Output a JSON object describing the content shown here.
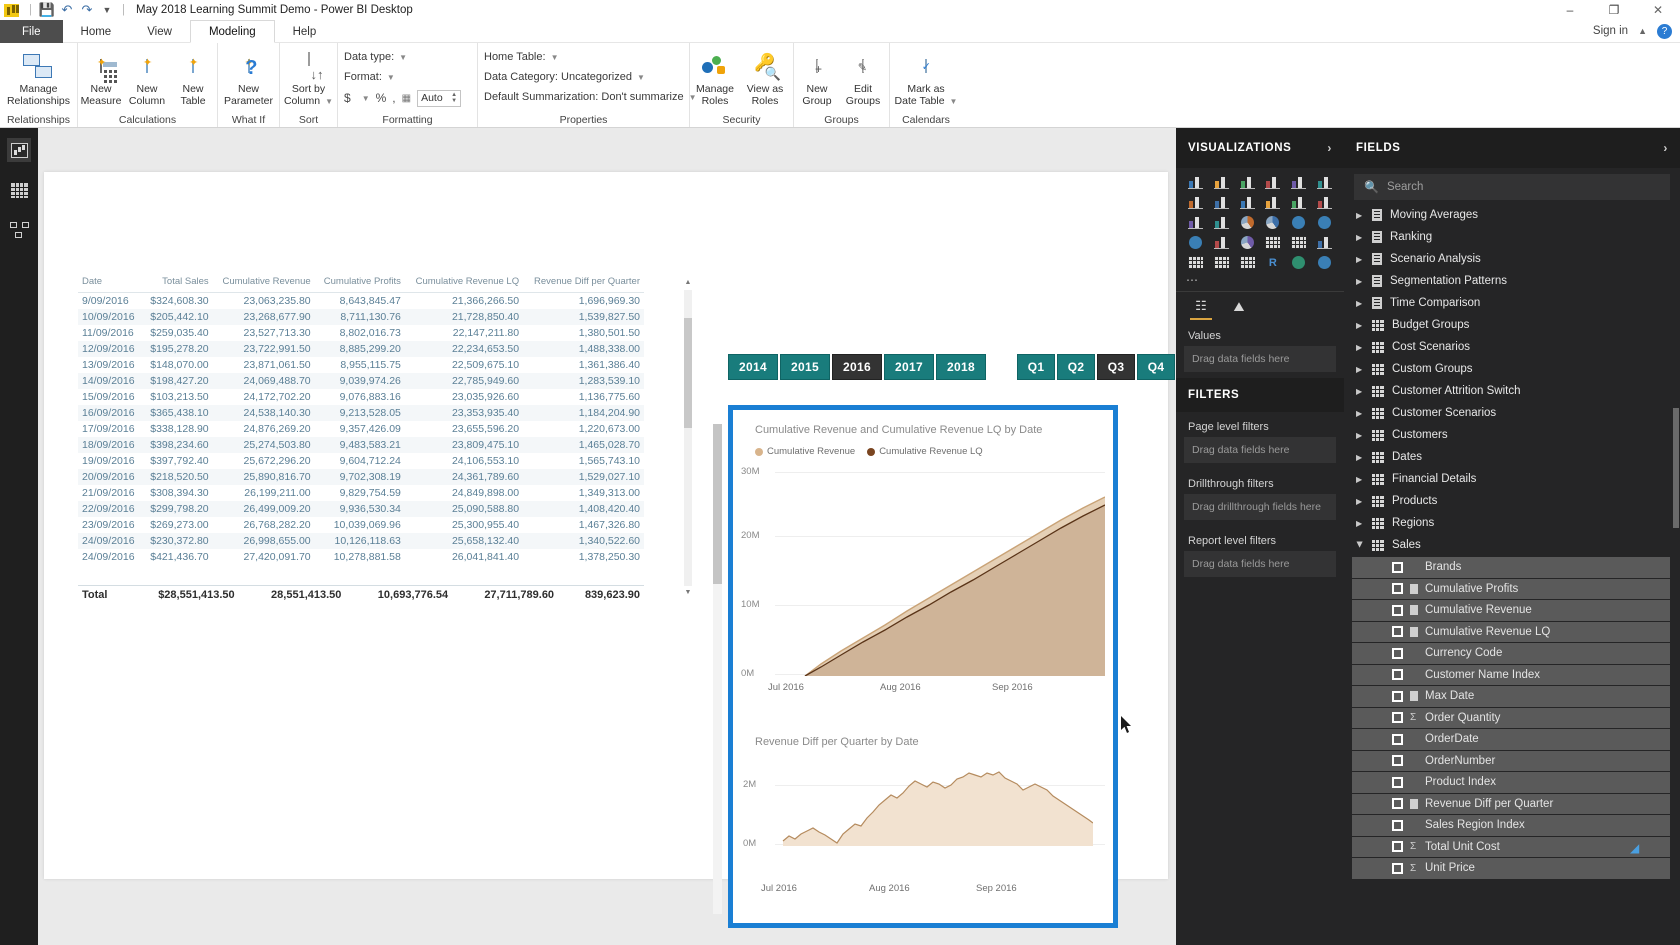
{
  "titlebar": {
    "app_title": "May 2018 Learning Summit Demo - Power BI Desktop",
    "save_icon": "save-icon",
    "undo_icon": "undo-icon",
    "redo_icon": "redo-icon",
    "customize_icon": "customize-quick-access-icon",
    "minimize": "–",
    "maximize": "❐",
    "close": "✕"
  },
  "menubar": {
    "tabs": [
      {
        "label": "File",
        "active": false,
        "file": true
      },
      {
        "label": "Home",
        "active": false
      },
      {
        "label": "View",
        "active": false
      },
      {
        "label": "Modeling",
        "active": true
      },
      {
        "label": "Help",
        "active": false
      }
    ],
    "signin_label": "Sign in",
    "help_label": "?"
  },
  "ribbon": {
    "groups": [
      {
        "name": "Relationships",
        "buttons": [
          {
            "line1": "Manage",
            "line2": "Relationships",
            "icon": "manage-relationships-icon"
          }
        ]
      },
      {
        "name": "Calculations",
        "buttons": [
          {
            "line1": "New",
            "line2": "Measure",
            "icon": "new-measure-icon"
          },
          {
            "line1": "New",
            "line2": "Column",
            "icon": "new-column-icon"
          },
          {
            "line1": "New",
            "line2": "Table",
            "icon": "new-table-icon"
          }
        ]
      },
      {
        "name": "What If",
        "buttons": [
          {
            "line1": "New",
            "line2": "Parameter",
            "icon": "new-parameter-icon"
          }
        ]
      },
      {
        "name": "Sort",
        "buttons": [
          {
            "line1": "Sort by",
            "line2": "Column",
            "icon": "sort-by-column-icon"
          }
        ]
      }
    ],
    "formatting": {
      "group_name": "Formatting",
      "data_type_label": "Data type:",
      "format_label": "Format:",
      "currency_symbol": "$",
      "percent_symbol": "%",
      "comma_symbol": ",",
      "decimal_icon": "decimal-places-icon",
      "auto_value": "Auto"
    },
    "properties": {
      "group_name": "Properties",
      "home_table_label": "Home Table:",
      "data_category_label": "Data Category: Uncategorized",
      "default_summarization_label": "Default Summarization: Don't summarize"
    },
    "security": {
      "group_name": "Security",
      "buttons": [
        {
          "line1": "Manage",
          "line2": "Roles",
          "icon": "manage-roles-icon"
        },
        {
          "line1": "View as",
          "line2": "Roles",
          "icon": "view-as-roles-icon"
        }
      ]
    },
    "groups_section": {
      "group_name": "Groups",
      "buttons": [
        {
          "line1": "New",
          "line2": "Group",
          "icon": "new-group-icon"
        },
        {
          "line1": "Edit",
          "line2": "Groups",
          "icon": "edit-groups-icon"
        }
      ]
    },
    "calendars": {
      "group_name": "Calendars",
      "buttons": [
        {
          "line1": "Mark as",
          "line2": "Date Table",
          "icon": "mark-as-date-table-icon"
        }
      ]
    }
  },
  "view_rail": {
    "items": [
      {
        "name": "report-view",
        "icon": "report-view-icon",
        "selected": true
      },
      {
        "name": "data-view",
        "icon": "data-view-icon",
        "selected": false
      },
      {
        "name": "model-view",
        "icon": "model-view-icon",
        "selected": false
      }
    ]
  },
  "table_visual": {
    "columns": [
      "Date",
      "Total Sales",
      "Cumulative Revenue",
      "Cumulative Profits",
      "Cumulative Revenue LQ",
      "Revenue Diff per Quarter"
    ],
    "rows": [
      [
        "9/09/2016",
        "$324,608.30",
        "23,063,235.80",
        "8,643,845.47",
        "21,366,266.50",
        "1,696,969.30"
      ],
      [
        "10/09/2016",
        "$205,442.10",
        "23,268,677.90",
        "8,711,130.76",
        "21,728,850.40",
        "1,539,827.50"
      ],
      [
        "11/09/2016",
        "$259,035.40",
        "23,527,713.30",
        "8,802,016.73",
        "22,147,211.80",
        "1,380,501.50"
      ],
      [
        "12/09/2016",
        "$195,278.20",
        "23,722,991.50",
        "8,885,299.20",
        "22,234,653.50",
        "1,488,338.00"
      ],
      [
        "13/09/2016",
        "$148,070.00",
        "23,871,061.50",
        "8,955,115.75",
        "22,509,675.10",
        "1,361,386.40"
      ],
      [
        "14/09/2016",
        "$198,427.20",
        "24,069,488.70",
        "9,039,974.26",
        "22,785,949.60",
        "1,283,539.10"
      ],
      [
        "15/09/2016",
        "$103,213.50",
        "24,172,702.20",
        "9,076,883.16",
        "23,035,926.60",
        "1,136,775.60"
      ],
      [
        "16/09/2016",
        "$365,438.10",
        "24,538,140.30",
        "9,213,528.05",
        "23,353,935.40",
        "1,184,204.90"
      ],
      [
        "17/09/2016",
        "$338,128.90",
        "24,876,269.20",
        "9,357,426.09",
        "23,655,596.20",
        "1,220,673.00"
      ],
      [
        "18/09/2016",
        "$398,234.60",
        "25,274,503.80",
        "9,483,583.21",
        "23,809,475.10",
        "1,465,028.70"
      ],
      [
        "19/09/2016",
        "$397,792.40",
        "25,672,296.20",
        "9,604,712.24",
        "24,106,553.10",
        "1,565,743.10"
      ],
      [
        "20/09/2016",
        "$218,520.50",
        "25,890,816.70",
        "9,702,308.19",
        "24,361,789.60",
        "1,529,027.10"
      ],
      [
        "21/09/2016",
        "$308,394.30",
        "26,199,211.00",
        "9,829,754.59",
        "24,849,898.00",
        "1,349,313.00"
      ],
      [
        "22/09/2016",
        "$299,798.20",
        "26,499,009.20",
        "9,936,530.34",
        "25,090,588.80",
        "1,408,420.40"
      ],
      [
        "23/09/2016",
        "$269,273.00",
        "26,768,282.20",
        "10,039,069.96",
        "25,300,955.40",
        "1,467,326.80"
      ],
      [
        "24/09/2016",
        "$230,372.80",
        "26,998,655.00",
        "10,126,118.63",
        "25,658,132.40",
        "1,340,522.60"
      ],
      [
        "24/09/2016",
        "$421,436.70",
        "27,420,091.70",
        "10,278,881.58",
        "26,041,841.40",
        "1,378,250.30"
      ]
    ],
    "total_row": [
      "Total",
      "$28,551,413.50",
      "28,551,413.50",
      "10,693,776.54",
      "27,711,789.60",
      "839,623.90"
    ]
  },
  "slicers": {
    "year": {
      "options": [
        "2014",
        "2015",
        "2016",
        "2017",
        "2018"
      ],
      "selected": "2016"
    },
    "quarter": {
      "options": [
        "Q1",
        "Q2",
        "Q3",
        "Q4"
      ],
      "selected": "Q3"
    }
  },
  "chart_data": [
    {
      "type": "area",
      "title": "Cumulative Revenue and Cumulative Revenue LQ by Date",
      "xlabel": "",
      "ylabel": "",
      "ylim": [
        0,
        32000000
      ],
      "yticks": [
        "0M",
        "10M",
        "20M",
        "30M"
      ],
      "xticks": [
        "Jul 2016",
        "Aug 2016",
        "Sep 2016"
      ],
      "grid": true,
      "legend_position": "top-left",
      "series": [
        {
          "name": "Cumulative Revenue",
          "color": "#d8b48c",
          "values": [
            0,
            1200000,
            2600000,
            4100000,
            5600000,
            7100000,
            8700000,
            10200000,
            11800000,
            13400000,
            15000000,
            16600000,
            18300000,
            19900000,
            21500000,
            23100000,
            24800000,
            26400000,
            27800000
          ]
        },
        {
          "name": "Cumulative Revenue LQ",
          "color": "#7a4520",
          "values": [
            0,
            1100000,
            2450000,
            3900000,
            5350000,
            6800000,
            8350000,
            9800000,
            11350000,
            12900000,
            14450000,
            16000000,
            17650000,
            19200000,
            20750000,
            22300000,
            23950000,
            25500000,
            26900000
          ]
        }
      ]
    },
    {
      "type": "area",
      "title": "Revenue Diff per Quarter by Date",
      "xlabel": "",
      "ylabel": "",
      "ylim": [
        0,
        2400000
      ],
      "yticks": [
        "0M",
        "2M"
      ],
      "xticks": [
        "Jul 2016",
        "Aug 2016",
        "Sep 2016"
      ],
      "grid": true,
      "legend_position": "none",
      "series": [
        {
          "name": "Revenue Diff per Quarter",
          "color": "#c79a6d",
          "values": [
            100000,
            160000,
            120000,
            210000,
            260000,
            300000,
            240000,
            190000,
            120000,
            60000,
            230000,
            330000,
            420000,
            380000,
            560000,
            700000,
            900000,
            1080000,
            1260000,
            1180000,
            1350000,
            1620000,
            1800000,
            1720000,
            1640000,
            1760000,
            1700000,
            1600000,
            1680000,
            1840000,
            1900000,
            2040000,
            1980000,
            1920000,
            2060000,
            2000000,
            2100000,
            1960000,
            1880000,
            1800000,
            1620000,
            1700000,
            1780000,
            1720000,
            1640000,
            1500000,
            1400000
          ]
        }
      ]
    }
  ],
  "visualizations_pane": {
    "header": "VISUALIZATIONS",
    "expand_icon": "chevron-right-icon",
    "icons": [
      "stacked-bar-chart-icon",
      "stacked-column-chart-icon",
      "clustered-bar-chart-icon",
      "clustered-column-chart-icon",
      "100-stacked-bar-icon",
      "100-stacked-column-icon",
      "line-chart-icon",
      "area-chart-icon",
      "stacked-area-chart-icon",
      "line-stacked-column-icon",
      "line-clustered-column-icon",
      "ribbon-chart-icon",
      "waterfall-chart-icon",
      "scatter-chart-icon",
      "pie-chart-icon",
      "donut-chart-icon",
      "treemap-icon",
      "map-icon",
      "filled-map-icon",
      "funnel-icon",
      "gauge-icon",
      "card-icon",
      "multi-row-card-icon",
      "kpi-icon",
      "slicer-icon",
      "table-icon",
      "matrix-icon",
      "r-script-visual-icon",
      "python-visual-icon",
      "arcgis-map-icon"
    ],
    "more_icon": "more-visuals-icon",
    "field_tabs": [
      {
        "name": "fields-tab",
        "icon": "fields-tab-icon",
        "active": true
      },
      {
        "name": "format-tab",
        "icon": "paint-roller-icon",
        "active": false
      }
    ],
    "wells": [
      {
        "label": "Values",
        "placeholder": "Drag data fields here"
      }
    ],
    "filters_header": "FILTERS",
    "filters": [
      {
        "label": "Page level filters",
        "placeholder": "Drag data fields here"
      },
      {
        "label": "Drillthrough filters",
        "placeholder": "Drag drillthrough fields here"
      },
      {
        "label": "Report level filters",
        "placeholder": "Drag data fields here"
      }
    ]
  },
  "fields_pane": {
    "header": "FIELDS",
    "expand_icon": "chevron-right-icon",
    "search_placeholder": "Search",
    "search_icon": "search-icon",
    "tables": [
      {
        "label": "Moving Averages",
        "kind": "calc-group",
        "expanded": false
      },
      {
        "label": "Ranking",
        "kind": "calc-group",
        "expanded": false
      },
      {
        "label": "Scenario Analysis",
        "kind": "calc-group",
        "expanded": false
      },
      {
        "label": "Segmentation Patterns",
        "kind": "calc-group",
        "expanded": false
      },
      {
        "label": "Time Comparison",
        "kind": "calc-group",
        "expanded": false
      },
      {
        "label": "Budget Groups",
        "kind": "table",
        "expanded": false
      },
      {
        "label": "Cost Scenarios",
        "kind": "table",
        "expanded": false
      },
      {
        "label": "Custom Groups",
        "kind": "table",
        "expanded": false
      },
      {
        "label": "Customer Attrition Switch",
        "kind": "table",
        "expanded": false
      },
      {
        "label": "Customer Scenarios",
        "kind": "table",
        "expanded": false
      },
      {
        "label": "Customers",
        "kind": "table",
        "expanded": false
      },
      {
        "label": "Dates",
        "kind": "table",
        "expanded": false
      },
      {
        "label": "Financial Details",
        "kind": "table",
        "expanded": false
      },
      {
        "label": "Products",
        "kind": "table",
        "expanded": false
      },
      {
        "label": "Regions",
        "kind": "table",
        "expanded": false
      },
      {
        "label": "Sales",
        "kind": "table",
        "expanded": true
      }
    ],
    "sales_fields": [
      {
        "label": "Brands",
        "type": "column"
      },
      {
        "label": "Cumulative Profits",
        "type": "measure"
      },
      {
        "label": "Cumulative Revenue",
        "type": "measure"
      },
      {
        "label": "Cumulative Revenue LQ",
        "type": "measure"
      },
      {
        "label": "Currency Code",
        "type": "column"
      },
      {
        "label": "Customer Name Index",
        "type": "column"
      },
      {
        "label": "Max Date",
        "type": "measure"
      },
      {
        "label": "Order Quantity",
        "type": "sum"
      },
      {
        "label": "OrderDate",
        "type": "column"
      },
      {
        "label": "OrderNumber",
        "type": "column"
      },
      {
        "label": "Product Index",
        "type": "column"
      },
      {
        "label": "Revenue Diff per Quarter",
        "type": "measure"
      },
      {
        "label": "Sales Region Index",
        "type": "column"
      },
      {
        "label": "Total Unit Cost",
        "type": "sum"
      },
      {
        "label": "Unit Price",
        "type": "sum"
      }
    ]
  },
  "colors": {
    "slicer_teal": "#197c7c",
    "slicer_selected": "#333333",
    "selection_border": "#1a7fd4",
    "revenue_light": "#d8b48c",
    "revenue_lq_dark": "#7a4520",
    "pane_bg": "#252526"
  }
}
